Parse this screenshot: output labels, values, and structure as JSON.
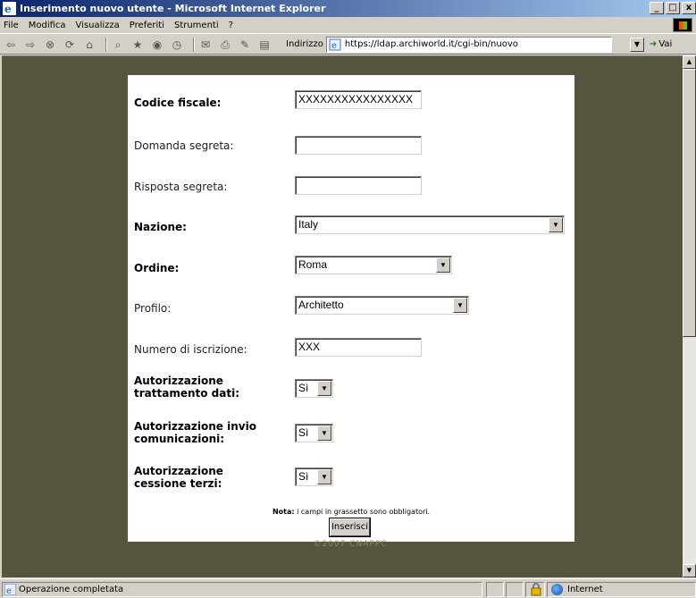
{
  "window": {
    "title": "Inserimento nuovo utente - Microsoft Internet Explorer",
    "controls": [
      "_",
      "□",
      "x"
    ]
  },
  "menu": [
    "File",
    "Modifica",
    "Visualizza",
    "Preferiti",
    "Strumenti",
    "?"
  ],
  "toolbar": {
    "address_label": "Indirizzo",
    "url": "https://ldap.archiworld.it/cgi-bin/nuovo",
    "go_label": "Vai"
  },
  "form": {
    "codice_fiscale_label": "Codice fiscale:",
    "codice_fiscale_value": "XXXXXXXXXXXXXXXX",
    "domanda_label": "Domanda segreta:",
    "domanda_value": "",
    "risposta_label": "Risposta segreta:",
    "risposta_value": "",
    "nazione_label": "Nazione:",
    "nazione_value": "Italy",
    "ordine_label": "Ordine:",
    "ordine_value": "Roma",
    "profilo_label": "Profilo:",
    "profilo_value": "Architetto",
    "numero_label": "Numero di iscrizione:",
    "numero_value": "XXX",
    "aut_trattamento_label": "Autorizzazione trattamento dati:",
    "aut_trattamento_value": "Sì",
    "aut_invio_label": "Autorizzazione invio comunicazioni:",
    "aut_invio_value": "Sì",
    "aut_cessione_label": "Autorizzazione cessione terzi:",
    "aut_cessione_value": "Sì",
    "nota_bold": "Nota:",
    "nota_text": " i campi in grassetto sono obbligatori.",
    "submit_label": "Inserisci",
    "copyright": "©2007 CNAPPC"
  },
  "status": {
    "text": "Operazione completata",
    "zone": "Internet"
  },
  "colors": {
    "page_background": "#56543c",
    "panel": "#ffffff",
    "chrome": "#d4d0c8"
  }
}
